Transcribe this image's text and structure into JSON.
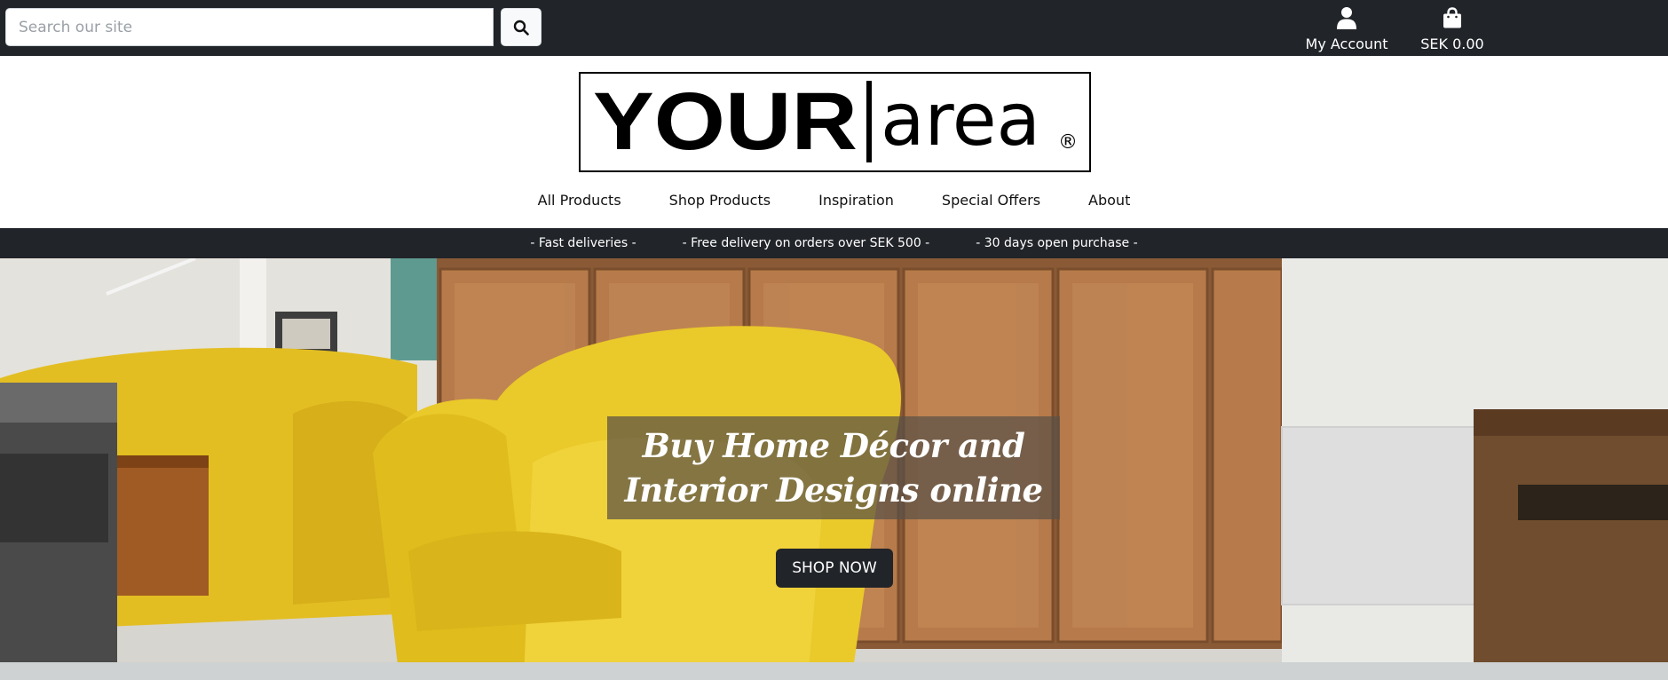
{
  "search": {
    "placeholder": "Search our site",
    "icon": "search-icon"
  },
  "header": {
    "account_label": "My Account",
    "cart_label": "SEK 0.00"
  },
  "logo": {
    "text_bold": "YOUR",
    "text_light": "area",
    "mark": "®"
  },
  "nav": {
    "items": [
      {
        "label": "All Products"
      },
      {
        "label": "Shop Products"
      },
      {
        "label": "Inspiration"
      },
      {
        "label": "Special Offers"
      },
      {
        "label": "About"
      }
    ]
  },
  "strip": {
    "items": [
      {
        "label": "-  Fast deliveries  -"
      },
      {
        "label": "-  Free delivery on orders over SEK 500  -"
      },
      {
        "label": "-  30 days open purchase  -"
      }
    ]
  },
  "hero": {
    "title_line1": "Buy Home Décor and",
    "title_line2": "Interior Designs online",
    "cta_label": "SHOP NOW"
  },
  "colors": {
    "dark": "#212429",
    "accent_yellow": "#e8c42a",
    "wood": "#b77a4a"
  }
}
